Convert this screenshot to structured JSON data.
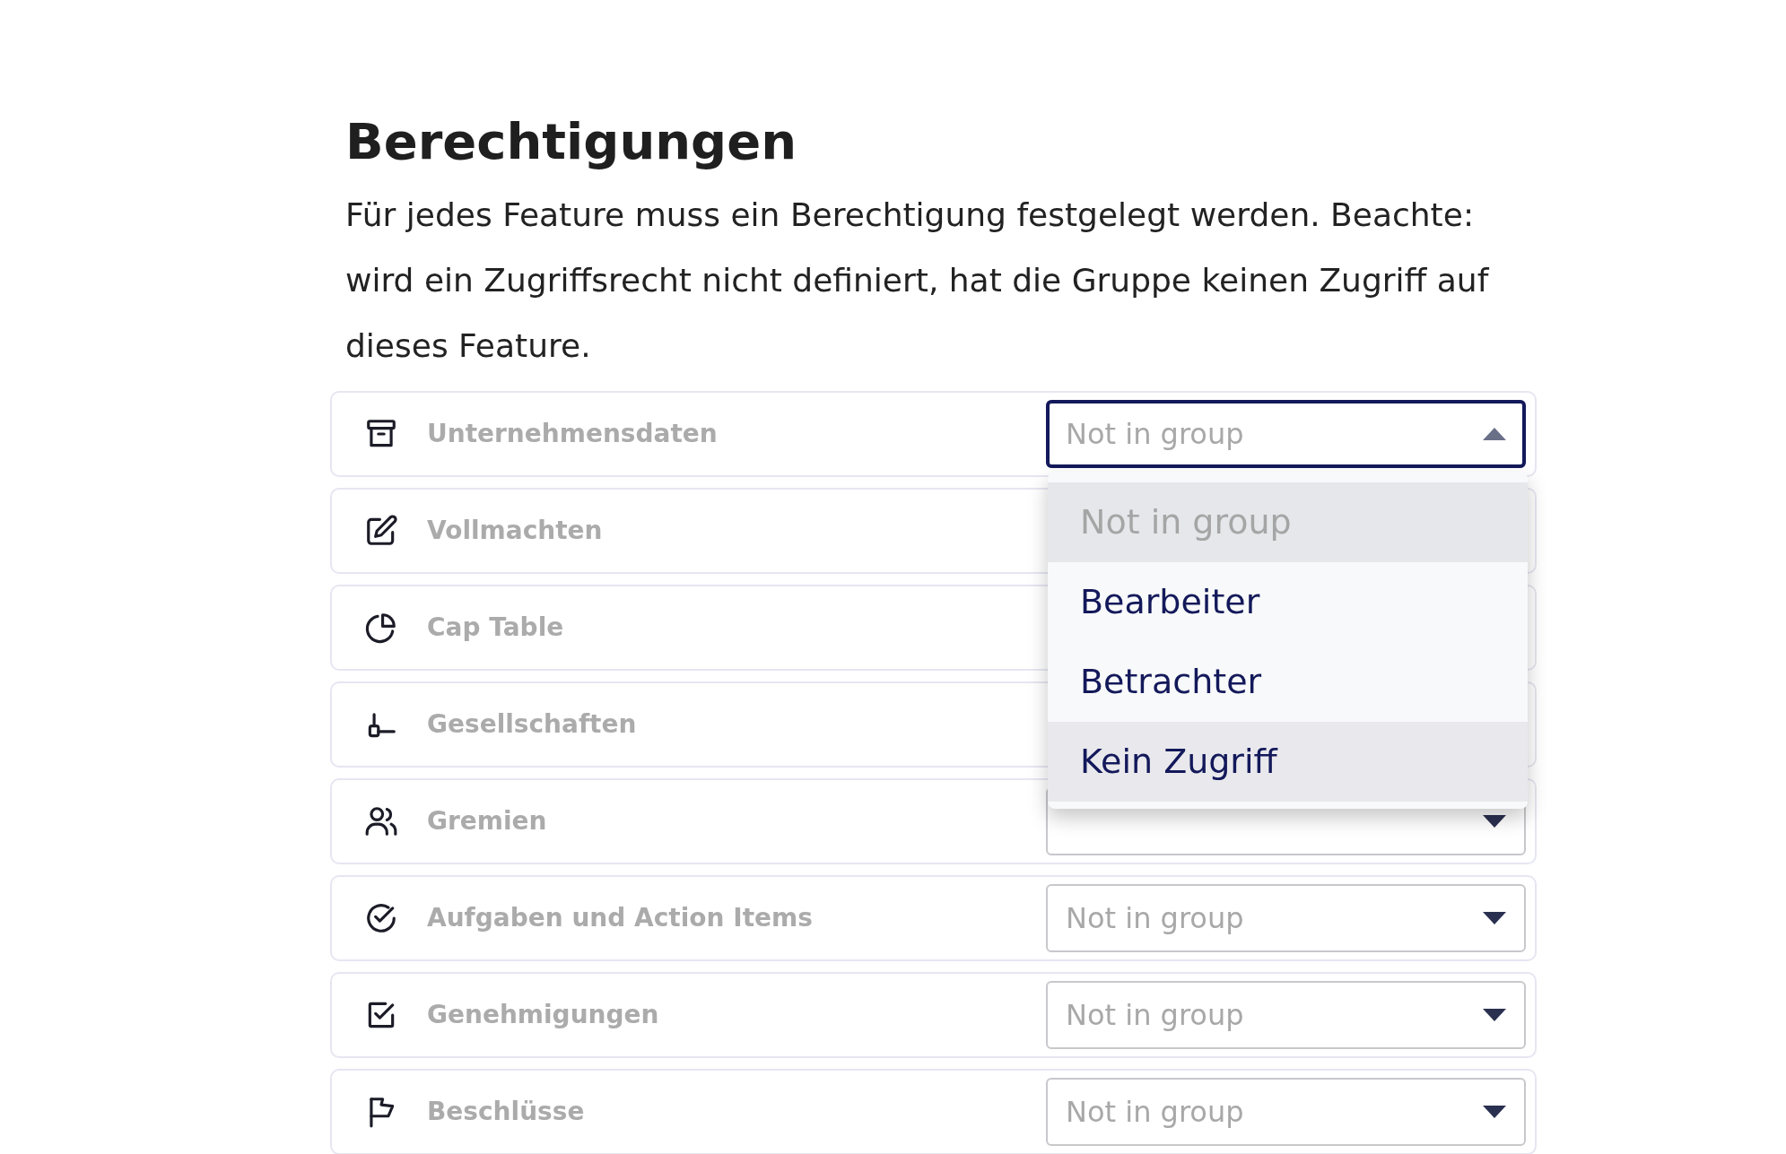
{
  "heading": "Berechtigungen",
  "description": "Für jedes Feature muss ein Berechtigung festgelegt werden. Beachte: wird ein Zugriffsrecht nicht definiert, hat die Gruppe keinen Zugriff auf dieses Feature.",
  "features": [
    {
      "label": "Unternehmensdaten",
      "kind": "archive",
      "select": {
        "placeholder": "Not in group",
        "expanded": true
      }
    },
    {
      "label": "Vollmachten",
      "kind": "edit"
    },
    {
      "label": "Cap Table",
      "kind": "pie"
    },
    {
      "label": "Gesellschaften",
      "kind": "hierarchy"
    },
    {
      "label": "Gremien",
      "kind": "users",
      "select": {
        "expanded": false
      }
    },
    {
      "label": "Aufgaben und Action Items",
      "kind": "check-circle",
      "select": {
        "placeholder": "Not in group",
        "expanded": false
      }
    },
    {
      "label": "Genehmigungen",
      "kind": "check-square",
      "select": {
        "placeholder": "Not in group",
        "expanded": false
      }
    },
    {
      "label": "Beschlüsse",
      "kind": "flag",
      "select": {
        "placeholder": "Not in group",
        "expanded": false
      }
    }
  ],
  "dropdown": {
    "options": [
      {
        "label": "Not in group",
        "selected": true,
        "hovered": false
      },
      {
        "label": "Bearbeiter",
        "selected": false,
        "hovered": false
      },
      {
        "label": "Betrachter",
        "selected": false,
        "hovered": false
      },
      {
        "label": "Kein Zugriff",
        "selected": false,
        "hovered": true
      }
    ]
  }
}
